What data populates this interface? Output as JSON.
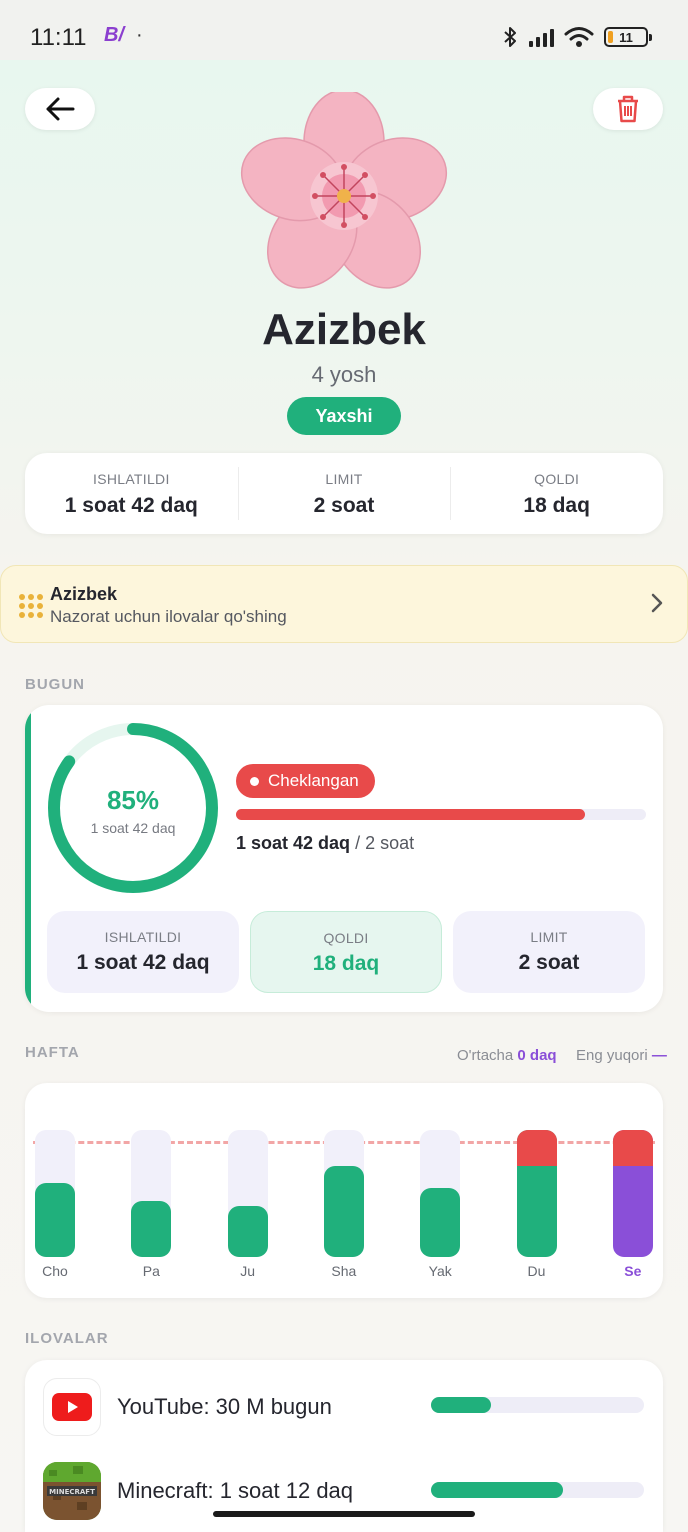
{
  "status_bar": {
    "time": "11:11",
    "app_glyph": "B/",
    "dot": "·",
    "battery": "11"
  },
  "colors": {
    "accent_green": "#20b07c",
    "alert_red": "#e84a4a",
    "today_purple": "#8a4fd8",
    "banner_bg": "#fdf6dc"
  },
  "header": {
    "back_icon": "arrow-left-icon",
    "delete_icon": "trash-icon",
    "avatar": "cherry-blossom-flower",
    "name": "Azizbek",
    "age": "4 yosh",
    "status": "Yaxshi"
  },
  "summary": [
    {
      "label": "ISHLATILDI",
      "value": "1 soat 42 daq"
    },
    {
      "label": "LIMIT",
      "value": "2 soat"
    },
    {
      "label": "QOLDI",
      "value": "18 daq"
    }
  ],
  "banner": {
    "icon": "apps-grid-icon",
    "title": "Azizbek",
    "subtitle": "Nazorat uchun ilovalar qo'shing"
  },
  "today": {
    "section": "BUGUN",
    "percent": "85%",
    "ring_sub": "1 soat 42 daq",
    "ring_fraction": 0.85,
    "status_pill": "Cheklangan",
    "bar_fraction": 0.85,
    "usage_used": "1 soat 42 daq",
    "usage_limit": "/ 2 soat",
    "boxes": [
      {
        "label": "ISHLATILDI",
        "value": "1 soat 42 daq"
      },
      {
        "label": "QOLDI",
        "value": "18 daq"
      },
      {
        "label": "LIMIT",
        "value": "2 soat"
      }
    ]
  },
  "week": {
    "section": "HAFTA",
    "avg_label": "O'rtacha",
    "avg_value": "0 daq",
    "max_label": "Eng yuqori",
    "max_value": "—",
    "days": [
      {
        "label": "Cho",
        "fraction": 0.58,
        "over": false,
        "today": false
      },
      {
        "label": "Pa",
        "fraction": 0.44,
        "over": false,
        "today": false
      },
      {
        "label": "Ju",
        "fraction": 0.4,
        "over": false,
        "today": false
      },
      {
        "label": "Sha",
        "fraction": 0.72,
        "over": false,
        "today": false
      },
      {
        "label": "Yak",
        "fraction": 0.54,
        "over": false,
        "today": false
      },
      {
        "label": "Du",
        "fraction": 1.0,
        "over": true,
        "today": false
      },
      {
        "label": "Se",
        "fraction": 1.0,
        "over": true,
        "today": true
      }
    ]
  },
  "apps": {
    "section": "ILOVALAR",
    "items": [
      {
        "name": "YouTube: 30 M bugun",
        "icon": "youtube-icon",
        "fraction": 0.28
      },
      {
        "name": "Minecraft: 1 soat 12 daq",
        "icon": "minecraft-icon",
        "fraction": 0.62
      }
    ]
  }
}
